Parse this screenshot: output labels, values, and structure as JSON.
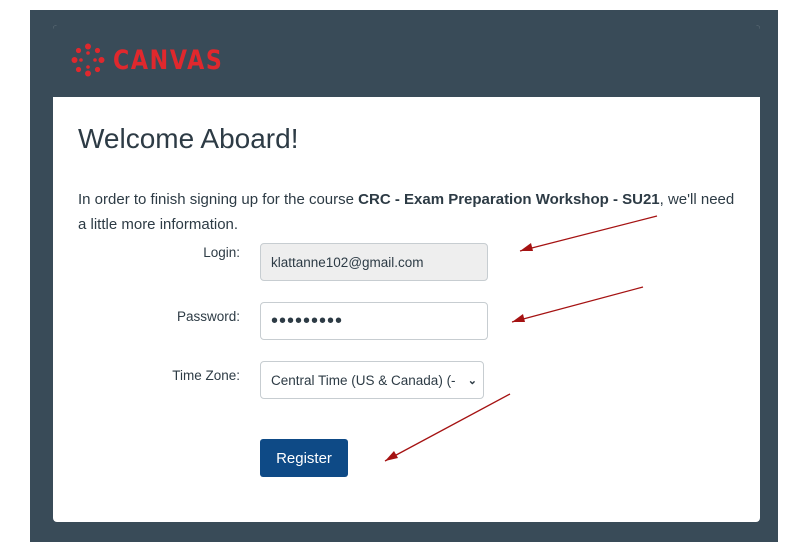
{
  "brand": {
    "name": "CANVAS",
    "color": "#e0282d",
    "icon": "canvas-logo-icon"
  },
  "page": {
    "title": "Welcome Aboard!",
    "intro_prefix": "In order to finish signing up for the course ",
    "course_name": "CRC - Exam Preparation Workshop - SU21",
    "intro_suffix": ", we'll need a little more information."
  },
  "form": {
    "login_label": "Login:",
    "login_value": "klattanne102@gmail.com",
    "password_label": "Password:",
    "password_mask": "•••••••••",
    "timezone_label": "Time Zone:",
    "timezone_value": "Central Time (US & Canada) (-",
    "register_label": "Register"
  },
  "annotations": {
    "arrow_color": "#a51212",
    "arrow_count": 4
  }
}
